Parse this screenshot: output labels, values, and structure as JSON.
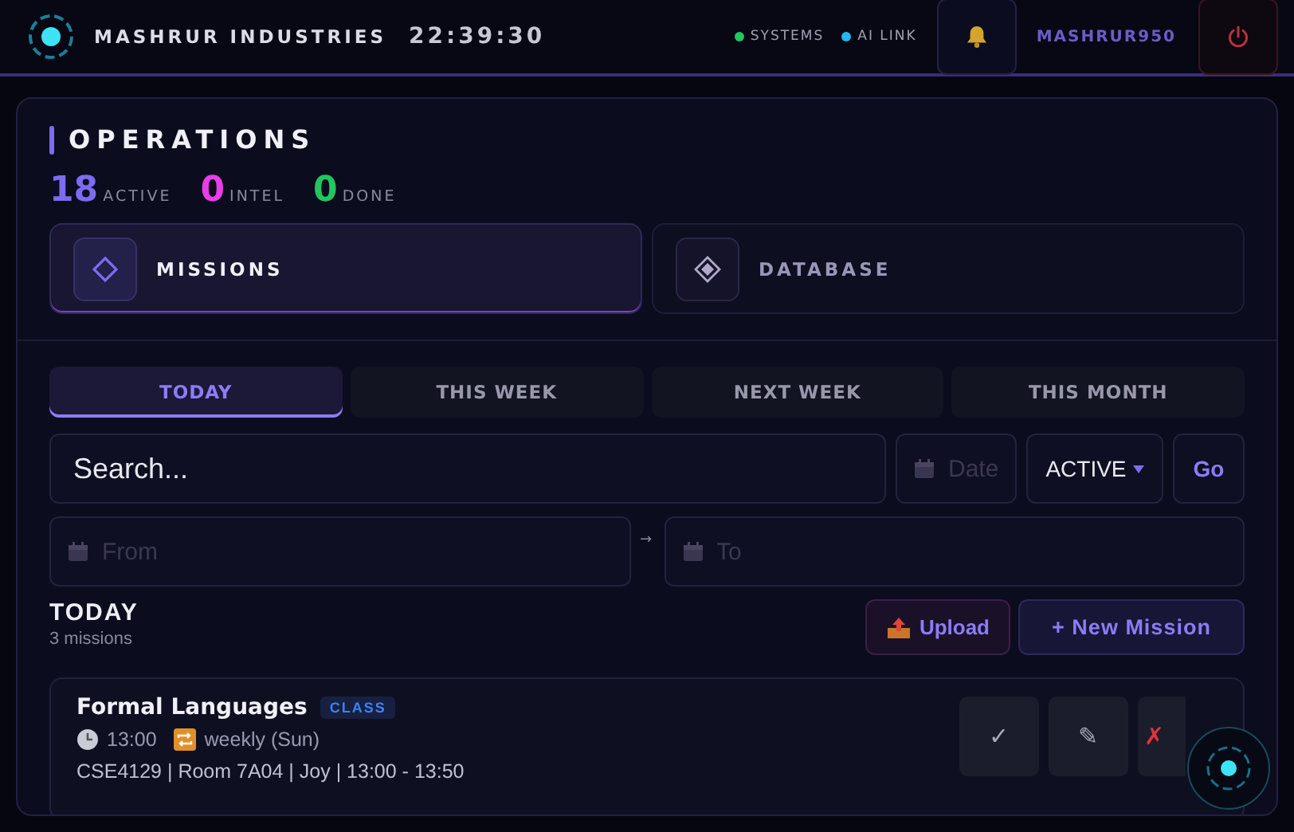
{
  "header": {
    "brand": "MASHRUR INDUSTRIES",
    "clock": "22:39:30",
    "indicators": [
      {
        "label": "SYSTEMS",
        "color": "#22c55e"
      },
      {
        "label": "AI LINK",
        "color": "#22b8f0"
      }
    ],
    "username": "MASHRUR950"
  },
  "panel": {
    "title": "OPERATIONS",
    "stats": [
      {
        "value": "18",
        "label": "ACTIVE",
        "color": "#7c6cf0"
      },
      {
        "value": "0",
        "label": "INTEL",
        "color": "#e83ee8"
      },
      {
        "value": "0",
        "label": "DONE",
        "color": "#22c55e"
      }
    ],
    "sections": [
      {
        "label": "MISSIONS",
        "kind": "outline",
        "selected": true
      },
      {
        "label": "DATABASE",
        "kind": "filled",
        "selected": false
      }
    ],
    "tabs": [
      {
        "label": "TODAY",
        "selected": true
      },
      {
        "label": "THIS WEEK",
        "selected": false
      },
      {
        "label": "NEXT WEEK",
        "selected": false
      },
      {
        "label": "THIS MONTH",
        "selected": false
      }
    ],
    "filters": {
      "search": {
        "placeholder": "Search..."
      },
      "date": {
        "placeholder": "Date"
      },
      "status": {
        "value": "ACTIVE"
      },
      "go": "Go",
      "from": {
        "placeholder": "From"
      },
      "separator": "→",
      "to": {
        "placeholder": "To"
      }
    },
    "list": {
      "heading": "TODAY",
      "count": "3 missions",
      "upload": "Upload",
      "new": "+ New Mission"
    },
    "missions": [
      {
        "title": "Formal Languages",
        "tag": "CLASS",
        "time": "13:00",
        "recurrence": "weekly (Sun)",
        "details": "CSE4129 | Room 7A04 | Joy | 13:00 - 13:50",
        "actions": [
          {
            "label": "✓",
            "kind": "complete"
          },
          {
            "label": "✎",
            "kind": "edit"
          },
          {
            "label": "✗",
            "kind": "delete"
          }
        ]
      }
    ]
  }
}
